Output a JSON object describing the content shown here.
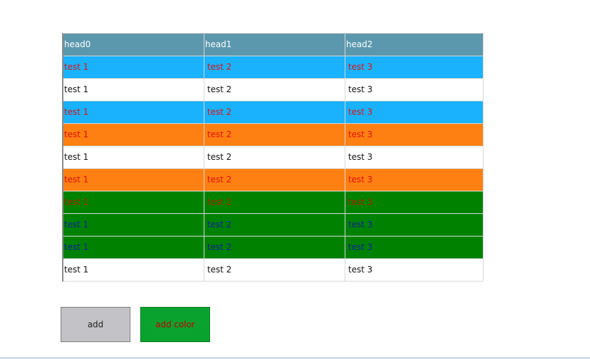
{
  "table": {
    "headers": [
      "head0",
      "head1",
      "head2"
    ],
    "header_bg": "#5b98ad",
    "header_fg": "#ffffff",
    "rows": [
      {
        "bg": "#1ab2fd",
        "fg": "#e01010",
        "cells": [
          "test 1",
          "test 2",
          "test 3"
        ]
      },
      {
        "bg": "#ffffff",
        "fg": "#111111",
        "cells": [
          "test 1",
          "test 2",
          "test 3"
        ]
      },
      {
        "bg": "#1ab2fd",
        "fg": "#e01010",
        "cells": [
          "test 1",
          "test 2",
          "test 3"
        ]
      },
      {
        "bg": "#fe8012",
        "fg": "#e01010",
        "cells": [
          "test 1",
          "test 2",
          "test 3"
        ]
      },
      {
        "bg": "#ffffff",
        "fg": "#111111",
        "cells": [
          "test 1",
          "test 2",
          "test 3"
        ]
      },
      {
        "bg": "#fe8012",
        "fg": "#e01010",
        "cells": [
          "test 1",
          "test 2",
          "test 3"
        ]
      },
      {
        "bg": "#008200",
        "fg": "#b02000",
        "cells": [
          "test 1",
          "test 2",
          "test 3"
        ]
      },
      {
        "bg": "#008200",
        "fg": "#10209a",
        "cells": [
          "test 1",
          "test 2",
          "test 3"
        ]
      },
      {
        "bg": "#008200",
        "fg": "#10209a",
        "cells": [
          "test 1",
          "test 2",
          "test 3"
        ]
      },
      {
        "bg": "#ffffff",
        "fg": "#111111",
        "cells": [
          "test 1",
          "test 2",
          "test 3"
        ]
      }
    ]
  },
  "buttons": {
    "add_label": "add",
    "add_color_label": "add color"
  }
}
